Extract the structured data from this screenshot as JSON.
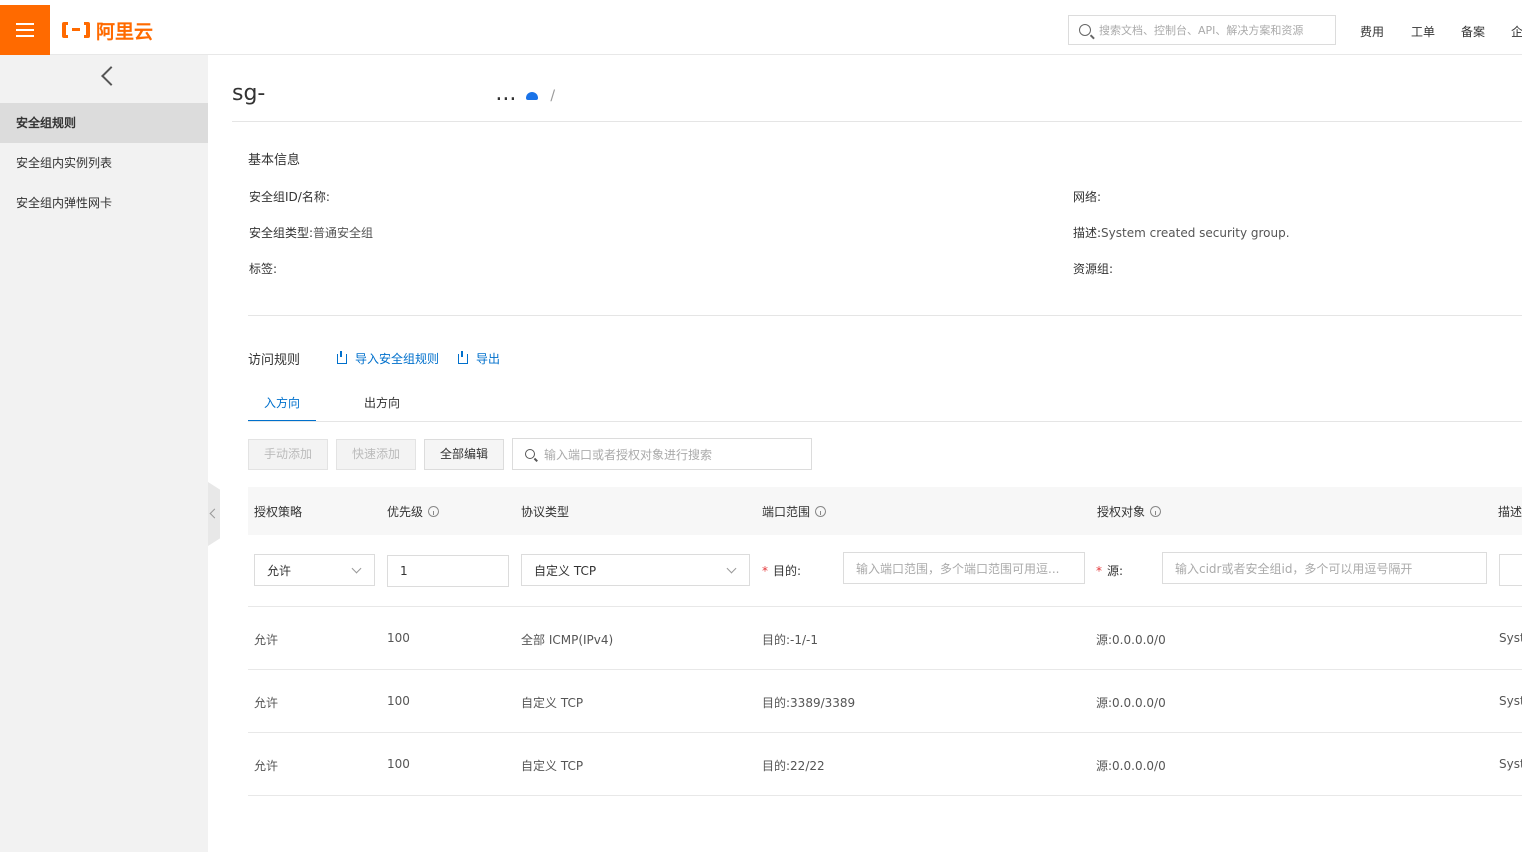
{
  "header": {
    "brand": "阿里云",
    "search_placeholder": "搜索文档、控制台、API、解决方案和资源",
    "nav": [
      "费用",
      "工单",
      "备案",
      "企"
    ]
  },
  "sidebar": {
    "items": [
      {
        "label": "安全组规则",
        "active": true
      },
      {
        "label": "安全组内实例列表",
        "active": false
      },
      {
        "label": "安全组内弹性网卡",
        "active": false
      }
    ]
  },
  "page": {
    "title_prefix": "sg-",
    "title_suffix": "...",
    "separator": "/"
  },
  "basic_info": {
    "section_title": "基本信息",
    "id_name_label": "安全组ID/名称:",
    "id_name_value": "",
    "network_label": "网络:",
    "network_value": "",
    "type_label": "安全组类型:",
    "type_value": "普通安全组",
    "desc_label": "描述:",
    "desc_value": "System created security group.",
    "tags_label": "标签:",
    "resource_group_label": "资源组:"
  },
  "rules": {
    "section_title": "访问规则",
    "import_label": "导入安全组规则",
    "export_label": "导出",
    "tabs": [
      {
        "label": "入方向",
        "active": true
      },
      {
        "label": "出方向",
        "active": false
      }
    ],
    "buttons": {
      "manual_add": "手动添加",
      "quick_add": "快速添加",
      "edit_all": "全部编辑"
    },
    "search_placeholder": "输入端口或者授权对象进行搜索",
    "columns": [
      "授权策略",
      "优先级",
      "协议类型",
      "端口范围",
      "授权对象",
      "描述"
    ],
    "edit_row": {
      "policy": "允许",
      "priority": "1",
      "protocol": "自定义 TCP",
      "dest_label": "目的:",
      "dest_placeholder": "输入端口范围，多个端口范围可用逗...",
      "src_label": "源:",
      "src_placeholder": "输入cidr或者安全组id，多个可以用逗号隔开"
    },
    "rows": [
      {
        "policy": "允许",
        "priority": "100",
        "protocol": "全部 ICMP(IPv4)",
        "port": "目的:-1/-1",
        "source": "源:0.0.0.0/0",
        "desc": "Syste"
      },
      {
        "policy": "允许",
        "priority": "100",
        "protocol": "自定义 TCP",
        "port": "目的:3389/3389",
        "source": "源:0.0.0.0/0",
        "desc": "Syste"
      },
      {
        "policy": "允许",
        "priority": "100",
        "protocol": "自定义 TCP",
        "port": "目的:22/22",
        "source": "源:0.0.0.0/0",
        "desc": "Syste"
      }
    ]
  }
}
